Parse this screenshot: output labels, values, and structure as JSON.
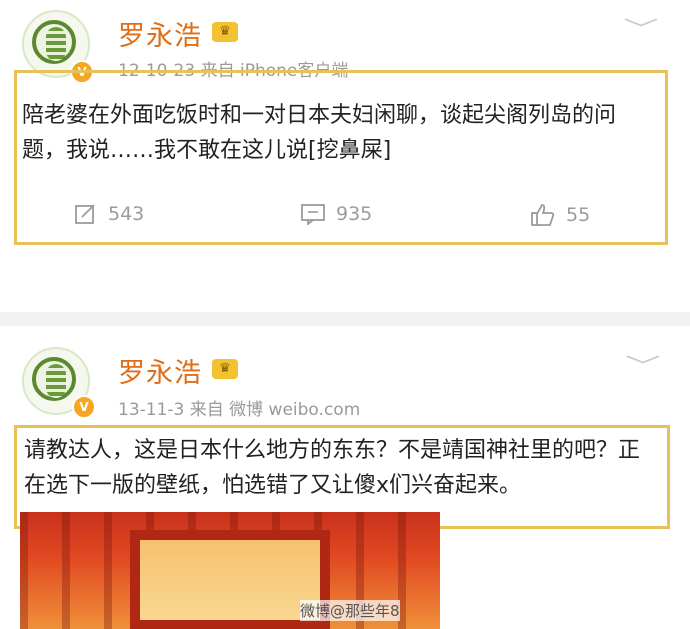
{
  "posts": [
    {
      "author": "罗永浩",
      "badge": "V",
      "crown": "♛",
      "meta": "12-10-23  来自 iPhone客户端",
      "content": "陪老婆在外面吃饭时和一对日本夫妇闲聊，谈起尖阁列岛的问题，我说……我不敢在这儿说[挖鼻屎]",
      "repost_count": "543",
      "comment_count": "935",
      "like_count": "55"
    },
    {
      "author": "罗永浩",
      "badge": "V",
      "crown": "♛",
      "meta": "13-11-3  来自 微博 weibo.com",
      "content": "请教达人，这是日本什么地方的东东？不是靖国神社里的吧？正在选下一版的壁纸，怕选错了又让傻x们兴奋起来。"
    }
  ],
  "watermark": "微博@那些年8",
  "colors": {
    "author": "#e06d17",
    "highlight": "#e8c15a",
    "meta": "#9a9a9a"
  },
  "icons": {
    "repost": "edit-icon",
    "comment": "comment-icon",
    "like": "thumbs-up-icon",
    "menu": "chevron-down-icon"
  }
}
